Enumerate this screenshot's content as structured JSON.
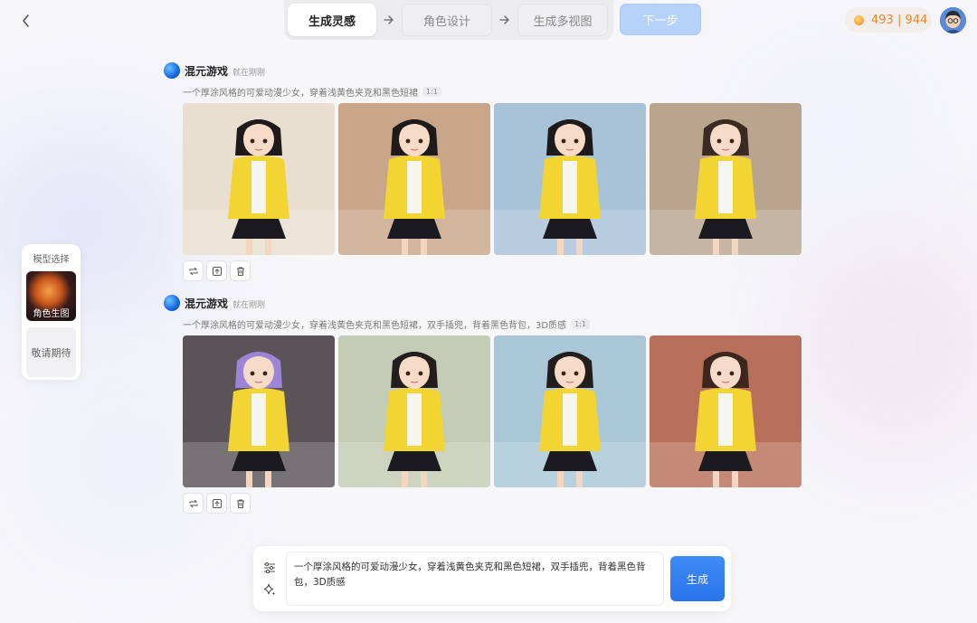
{
  "header": {
    "steps": [
      {
        "label": "生成灵感",
        "active": true
      },
      {
        "label": "角色设计",
        "active": false
      },
      {
        "label": "生成多视图",
        "active": false
      }
    ],
    "next_label": "下一步",
    "credits": "493 | 944"
  },
  "model_panel": {
    "title": "模型选择",
    "items": [
      {
        "label": "角色生图",
        "active": true
      },
      {
        "label": "敬请期待",
        "active": false
      }
    ]
  },
  "feed": [
    {
      "author": "混元游戏",
      "time": "就在刚刚",
      "prompt": "一个厚涂风格的可爱动漫少女，穿着浅黄色夹克和黑色短裙",
      "ratio": "1:1",
      "images": [
        {
          "bg": "#e9dfd0",
          "hair": "#1e1a1a",
          "backpack": false
        },
        {
          "bg": "#c9a58a",
          "hair": "#1e1a1a",
          "backpack": false
        },
        {
          "bg": "#a8c3d8",
          "hair": "#1e1a1a",
          "backpack": false
        },
        {
          "bg": "#b9a58e",
          "hair": "#3a2a22",
          "backpack": false
        }
      ]
    },
    {
      "author": "混元游戏",
      "time": "就在刚刚",
      "prompt": "一个厚涂风格的可爱动漫少女，穿着浅黄色夹克和黑色短裙，双手插兜，背着黑色背包，3D质感",
      "ratio": "1:1",
      "images": [
        {
          "bg": "#5a5458",
          "hair": "#9c85d6",
          "backpack": true
        },
        {
          "bg": "#c3ccb4",
          "hair": "#231e1c",
          "backpack": true
        },
        {
          "bg": "#a9c7d7",
          "hair": "#231e1c",
          "backpack": true
        },
        {
          "bg": "#b9705a",
          "hair": "#3c261e",
          "backpack": true
        }
      ]
    }
  ],
  "composer": {
    "text": "一个厚涂风格的可爱动漫少女，穿着浅黄色夹克和黑色短裙，双手插兜，背着黑色背包，3D质感",
    "generate_label": "生成"
  },
  "colors": {
    "accent": "#2f7bf0",
    "credits": "#e7892b",
    "jacket": "#f2d433",
    "skirt": "#1b1b1f"
  }
}
